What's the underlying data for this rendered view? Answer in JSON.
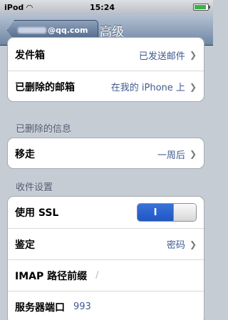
{
  "status": {
    "carrier": "iPod",
    "time": "15:24",
    "battery_level": 0.9
  },
  "nav": {
    "back_label_suffix": "@qq.com",
    "title": "高级"
  },
  "mailboxes": [
    {
      "label": "发件箱",
      "value": "已发送邮件"
    },
    {
      "label": "已删除的邮箱",
      "value": "在我的 iPhone 上"
    }
  ],
  "deleted_messages": {
    "header": "已删除的信息",
    "row": {
      "label": "移走",
      "value": "一周后"
    }
  },
  "incoming": {
    "header": "收件设置",
    "ssl": {
      "label": "使用 SSL",
      "toggle_text": "I",
      "state": "on"
    },
    "auth": {
      "label": "鉴定",
      "value": "密码"
    },
    "imap_prefix": {
      "label": "IMAP 路径前缀",
      "value": "/"
    },
    "port": {
      "label": "服务器端口",
      "value": "993"
    }
  }
}
